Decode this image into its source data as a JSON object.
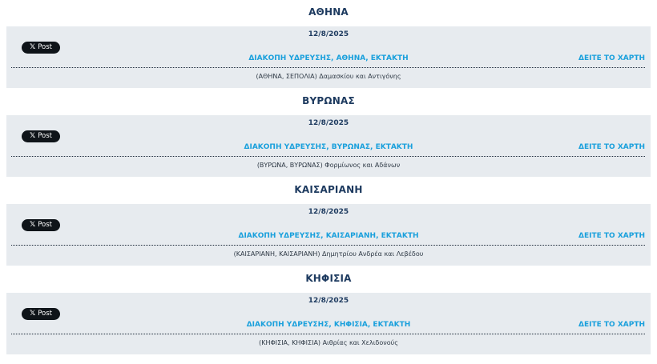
{
  "post_button_label": "Post",
  "x_glyph": "𝕏",
  "regions": [
    {
      "title": "ΑΘΗΝΑ",
      "date": "12/8/2025",
      "headline": "ΔΙΑΚΟΠΗ ΥΔΡΕΥΣΗΣ, ΑΘΗΝΑ, ΕΚΤΑΚΤΗ",
      "map_link": "ΔΕΙΤΕ ΤΟ ΧΑΡΤΗ",
      "address": "(ΑΘΗΝΑ, ΣΕΠΟΛΙΑ) Δαμασκίου και Αντιγόνης"
    },
    {
      "title": "ΒΥΡΩΝΑΣ",
      "date": "12/8/2025",
      "headline": "ΔΙΑΚΟΠΗ ΥΔΡΕΥΣΗΣ, ΒΥΡΩΝΑΣ, ΕΚΤΑΚΤΗ",
      "map_link": "ΔΕΙΤΕ ΤΟ ΧΑΡΤΗ",
      "address": "(ΒΥΡΩΝΑ, ΒΥΡΩΝΑΣ) Φορμίωνος και Αδάνων"
    },
    {
      "title": "ΚΑΙΣΑΡΙΑΝΗ",
      "date": "12/8/2025",
      "headline": "ΔΙΑΚΟΠΗ ΥΔΡΕΥΣΗΣ, ΚΑΙΣΑΡΙΑΝΗ, ΕΚΤΑΚΤΗ",
      "map_link": "ΔΕΙΤΕ ΤΟ ΧΑΡΤΗ",
      "address": "(ΚΑΙΣΑΡΙΑΝΗ, ΚΑΙΣΑΡΙΑΝΗ) Δημητρίου Ανδρέα και Λεβέδου"
    },
    {
      "title": "ΚΗΦΙΣΙΑ",
      "date": "12/8/2025",
      "headline": "ΔΙΑΚΟΠΗ ΥΔΡΕΥΣΗΣ, ΚΗΦΙΣΙΑ, ΕΚΤΑΚΤΗ",
      "map_link": "ΔΕΙΤΕ ΤΟ ΧΑΡΤΗ",
      "address": "(ΚΗΦΙΣΙΑ, ΚΗΦΙΣΙΑ) Αιθρίας και Χελιδονούς"
    }
  ],
  "colors": {
    "heading": "#1d3a5f",
    "link": "#1aa0dc",
    "card_background": "#e7ebef",
    "post_button": "#0f1419"
  }
}
